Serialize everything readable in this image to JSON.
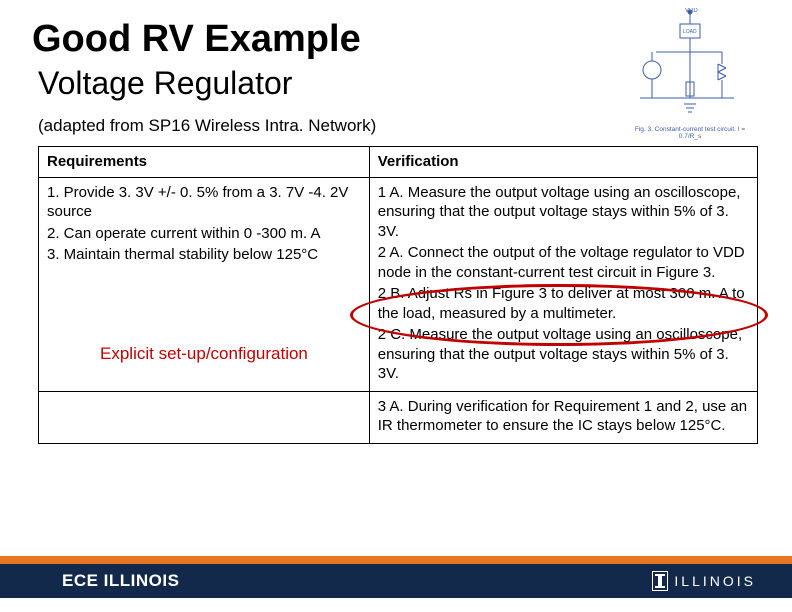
{
  "title": "Good RV Example",
  "subtitle": "Voltage Regulator",
  "source": "(adapted from SP16 Wireless Intra. Network)",
  "circuit_caption": "Fig. 3. Constant-current test circuit. I = 0.7/R_s",
  "circuit_labels": {
    "vdd": "VDD",
    "load": "LOAD"
  },
  "table": {
    "header_req": "Requirements",
    "header_ver": "Verification",
    "requirements": [
      "1. Provide 3. 3V +/- 0. 5% from a 3. 7V -4. 2V source",
      "2. Can operate current within 0 -300 m. A",
      "3. Maintain thermal stability below 125°C"
    ],
    "verification_block1": [
      "1 A. Measure the output voltage using an oscilloscope, ensuring that the output voltage stays within 5% of 3. 3V.",
      "",
      "2 A. Connect the output of the voltage regulator to VDD node in the constant-current test circuit in Figure 3.",
      "2 B. Adjust Rs in Figure 3 to deliver at most 300 m. A to the load, measured by a multimeter.",
      "2 C. Measure the output voltage using an oscilloscope, ensuring that the output voltage stays within 5% of 3. 3V."
    ],
    "verification_block2": [
      "3 A. During verification for Requirement 1 and 2, use an IR thermometer to ensure the IC stays below 125°C."
    ]
  },
  "annotation": "Explicit set-up/configuration",
  "footer": {
    "left": "ECE ILLINOIS",
    "right": "ILLINOIS"
  }
}
